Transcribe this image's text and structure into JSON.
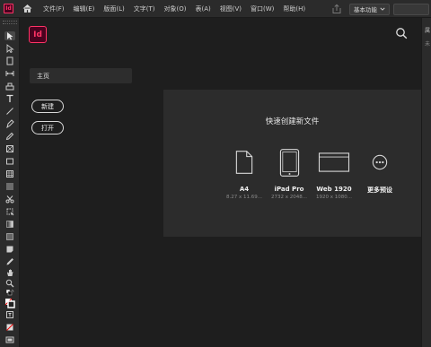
{
  "menubar": {
    "app_logo": "Id",
    "items": [
      "文件(F)",
      "编辑(E)",
      "版面(L)",
      "文字(T)",
      "对象(O)",
      "表(A)",
      "视图(V)",
      "窗口(W)",
      "帮助(H)"
    ],
    "workspace": "基本功能"
  },
  "home": {
    "logo": "Id",
    "nav_home": "主页",
    "new_button": "新建",
    "open_button": "打开",
    "quick_title": "快速创建新文件",
    "presets": [
      {
        "name": "A4",
        "size": "8.27 x 11.69...",
        "icon": "document-icon"
      },
      {
        "name": "iPad Pro",
        "size": "2732 x 2048...",
        "icon": "tablet-icon"
      },
      {
        "name": "Web 1920",
        "size": "1920 x 1080...",
        "icon": "web-screen-icon"
      },
      {
        "name": "更多预设",
        "size": "",
        "icon": "more-icon"
      }
    ]
  },
  "rightpanel": {
    "label1": "属",
    "label2": "未"
  },
  "colors": {
    "accent_id": "#ff3366",
    "panel_bg": "#2c2c2c",
    "app_bg": "#1e1e1e"
  }
}
